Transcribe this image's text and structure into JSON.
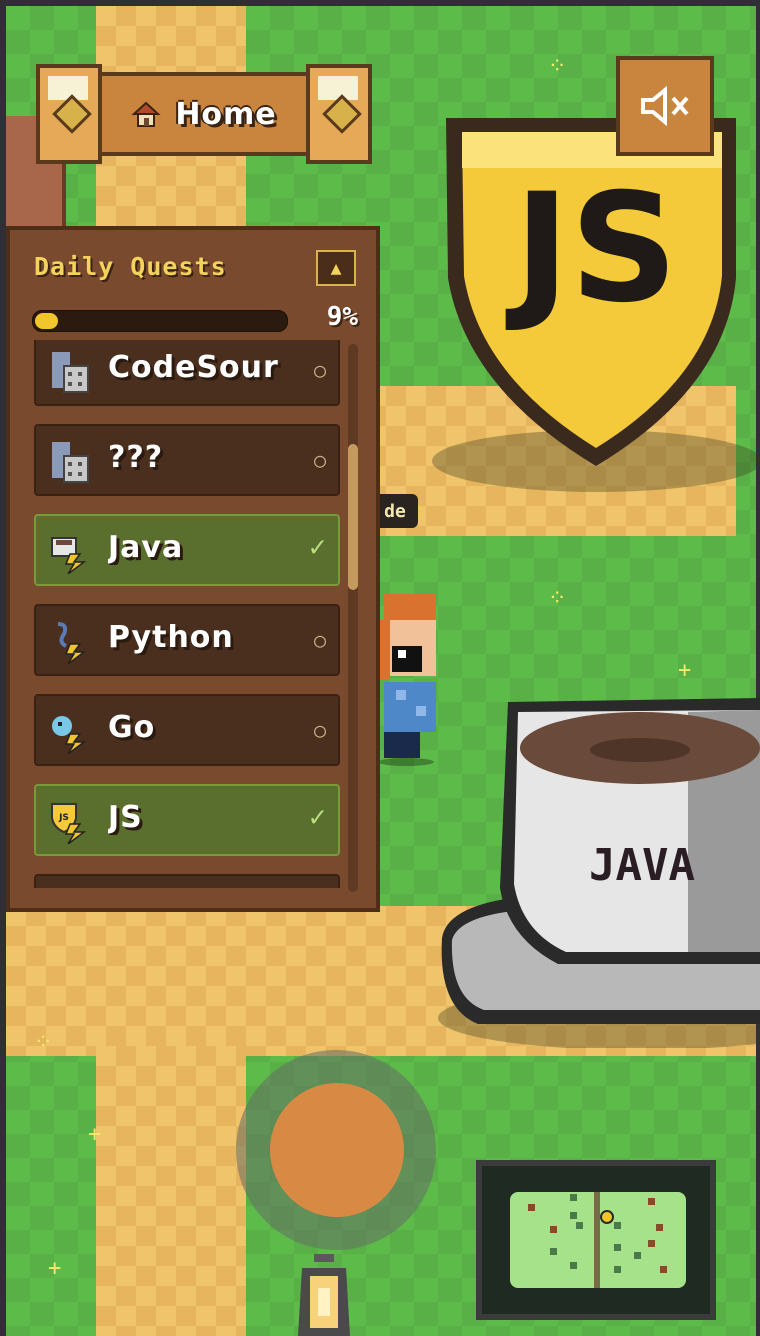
{
  "hud": {
    "home_label": "Home",
    "mute_icon": "speaker-muted-icon"
  },
  "world": {
    "sign_fragment_text": "de",
    "js_shield_text": "JS",
    "cup_text": "JAVA"
  },
  "daily_quests": {
    "title": "Daily Quests",
    "collapse_symbol": "▲",
    "progress_fraction": 0.09,
    "progress_text": "9%",
    "items": [
      {
        "label": "CodeSour",
        "icon": "building-icon",
        "completed": false,
        "status_symbol": "○"
      },
      {
        "label": "???",
        "icon": "building-icon",
        "completed": false,
        "status_symbol": "○"
      },
      {
        "label": "Java",
        "icon": "java-cup-bolt-icon",
        "completed": true,
        "status_symbol": "✓"
      },
      {
        "label": "Python",
        "icon": "python-snake-bolt-icon",
        "completed": false,
        "status_symbol": "○"
      },
      {
        "label": "Go",
        "icon": "go-gopher-bolt-icon",
        "completed": false,
        "status_symbol": "○"
      },
      {
        "label": "JS",
        "icon": "js-shield-bolt-icon",
        "completed": true,
        "status_symbol": "✓"
      },
      {
        "label": "",
        "icon": "",
        "completed": false,
        "status_symbol": ""
      }
    ]
  },
  "colors": {
    "grass": "#5dbb4a",
    "path": "#f0c46a",
    "panel": "#7a4a2e",
    "quest_title": "#f3d35a",
    "completed_item": "#5a6e2e",
    "progress_fill": "#f1c52c",
    "joystick_knob": "#d88a44"
  }
}
